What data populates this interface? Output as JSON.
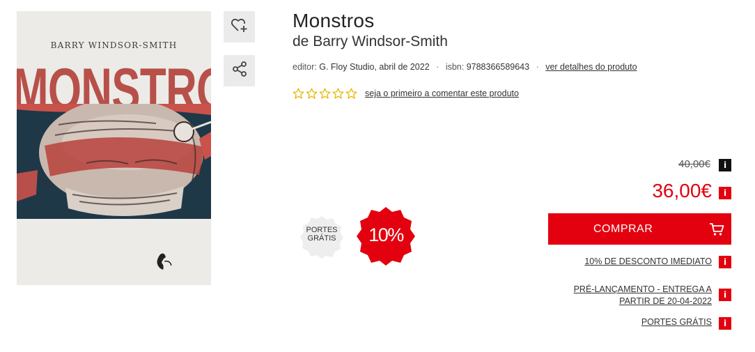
{
  "cover": {
    "author": "BARRY WINDSOR-SMITH",
    "title": "MONSTROS"
  },
  "actions": {
    "wishlist_icon": "heart-plus-icon",
    "share_icon": "share-icon"
  },
  "product": {
    "title": "Monstros",
    "author": "de Barry Windsor-Smith",
    "editor_label": "editor:",
    "editor_value": "G. Floy Studio, abril de 2022",
    "isbn_label": "isbn:",
    "isbn_value": "9788366589643",
    "details_link": "ver detalhes do produto"
  },
  "rating": {
    "stars": 0,
    "max": 5,
    "comment_link": "seja o primeiro a comentar este produto"
  },
  "badges": {
    "free_shipping": "PORTES GRÁTIS",
    "discount": "10%"
  },
  "price": {
    "old": "40,00€",
    "new": "36,00€",
    "buy_label": "COMPRAR",
    "discount_note": "10% DE DESCONTO IMEDIATO",
    "prelaunch": "PRÉ-LANÇAMENTO - ENTREGA A PARTIR DE 20-04-2022",
    "free_shipping": "PORTES GRÁTIS"
  },
  "colors": {
    "accent": "#e3000f",
    "info_dark": "#111111"
  }
}
